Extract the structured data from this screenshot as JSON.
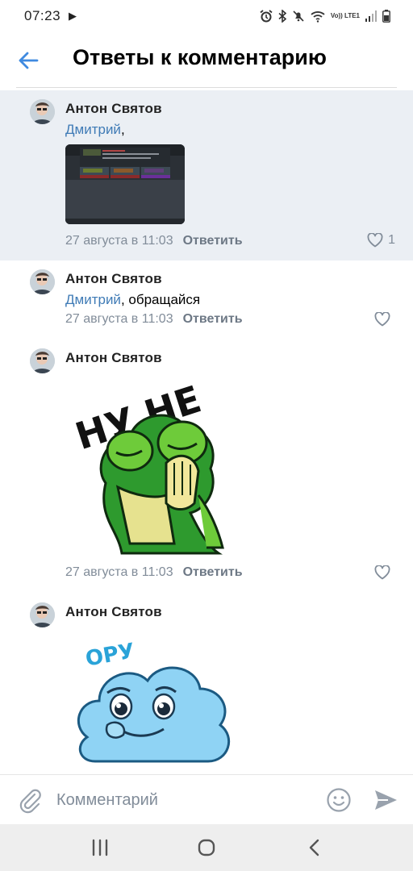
{
  "status_bar": {
    "time": "07:23",
    "network_label": "Vo)) LTE1"
  },
  "header": {
    "title": "Ответы к комментарию",
    "back_icon": "arrow-left-icon",
    "accent_color": "#3f8ae0"
  },
  "comments": [
    {
      "author": "Антон Святов",
      "mention": "Дмитрий",
      "text": ",",
      "attachment": "image-thumbnail",
      "date": "27 августа в 11:03",
      "reply_label": "Ответить",
      "likes": "1",
      "highlighted": true
    },
    {
      "author": "Антон Святов",
      "mention": "Дмитрий",
      "text": ", обращайся",
      "date": "27 августа в 11:03",
      "reply_label": "Ответить",
      "likes": ""
    },
    {
      "author": "Антон Святов",
      "sticker_text": "НУ НЕ",
      "sticker": "frog-facepalm-sticker",
      "date": "27 августа в 11:03",
      "reply_label": "Ответить",
      "likes": ""
    },
    {
      "author": "Антон Святов",
      "sticker_text": "ОРУ",
      "sticker": "crying-cloud-sticker"
    }
  ],
  "input": {
    "placeholder": "Комментарий"
  },
  "colors": {
    "mention": "#3f7bb6",
    "meta": "#818c99",
    "highlight_bg": "#ebeff4"
  }
}
